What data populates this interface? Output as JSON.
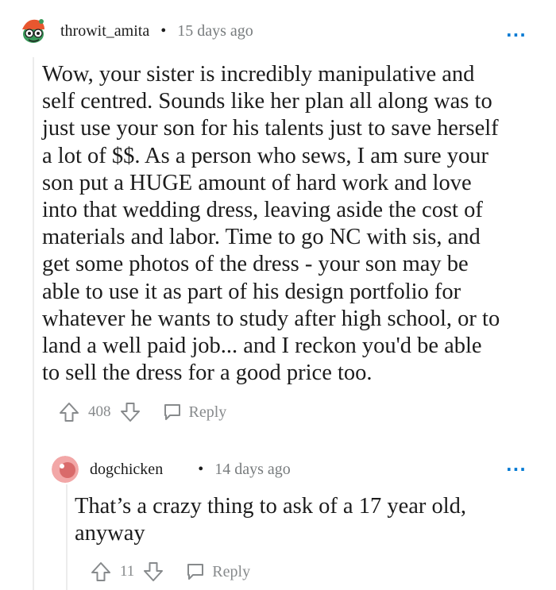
{
  "comment": {
    "username": "throwit_amita",
    "separator": "•",
    "timestamp": "15 days ago",
    "more_label": "···",
    "body_lines": [
      "Wow, your sister is incredibly manipulative and",
      "self centred. Sounds like her plan all along was to",
      "just use your son for his talents just to save herself",
      "a lot of $$. As a person who sews, I am sure your",
      "son put a HUGE amount of hard work and love",
      "into that wedding dress, leaving aside the cost of",
      "materials and labor. Time to go NC with sis, and",
      "get some photos of the dress - your son may be",
      "able to use it as part of his design portfolio for",
      "whatever he wants to study after high school, or to",
      "land a well paid job... and I reckon you'd be able",
      "to sell the dress for a good price too."
    ],
    "votes": "408",
    "reply_label": "Reply",
    "icons": {
      "upvote": "upvote-icon",
      "downvote": "downvote-icon",
      "reply": "speech-bubble-icon",
      "avatar": "avatar"
    }
  },
  "reply": {
    "username": "dogchicken",
    "separator": "•",
    "timestamp": "14 days ago",
    "more_label": "···",
    "body_lines": [
      "That’s a crazy thing to ask of a 17 year old,",
      "anyway"
    ],
    "votes": "11",
    "reply_label": "Reply"
  },
  "colors": {
    "text": "#1c1c1c",
    "meta": "#787c7e",
    "action": "#878a8c",
    "accent": "#0079d3",
    "thread_line": "#ececec",
    "reply_avatar": "#f2a7a7"
  }
}
